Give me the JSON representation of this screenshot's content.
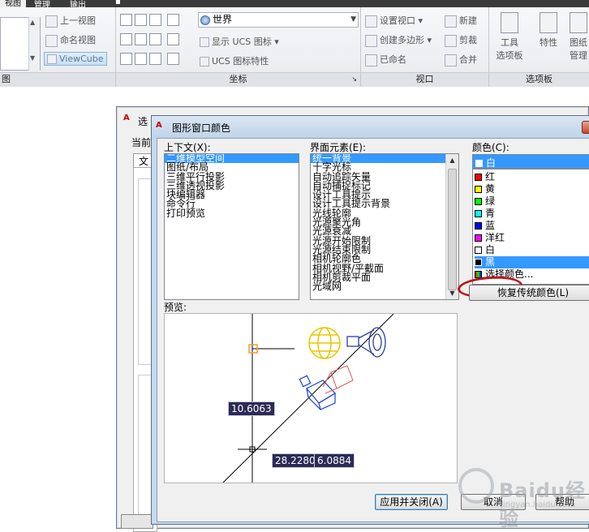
{
  "ribbon": {
    "tabs": [
      "视图",
      "管理",
      "输出"
    ],
    "view": {
      "upper_view": "上一视图",
      "named_view": "命名视图",
      "viewcube": "ViewCube"
    },
    "coords": {
      "world": "世界",
      "show_ucs_icon": "显示 UCS 图标",
      "ucs_icon_props": "UCS 图标特性",
      "panel_title": "坐标"
    },
    "viewport": {
      "set_viewport": "设置视口",
      "new": "新建",
      "create_polygon": "创建多边形",
      "clip": "剪裁",
      "named": "已命名",
      "merge": "合并",
      "panel_title": "视口"
    },
    "palettes": {
      "tool_palette_1": "工具",
      "tool_palette_2": "选项板",
      "properties": "特性",
      "sheet_set_1": "图纸",
      "sheet_set_2": "管理",
      "panel_title": "选项板"
    },
    "left_panel_title": "图"
  },
  "options_dialog": {
    "title_fragment": "选",
    "current_fragment": "当前",
    "tab_fragment": "文"
  },
  "color_dialog": {
    "title": "图形窗口颜色",
    "context_label": "上下文(X):",
    "contexts": [
      "二维模型空间",
      "图纸/布局",
      "三维平行投影",
      "三维透视投影",
      "块编辑器",
      "命令行",
      "打印预览"
    ],
    "element_label": "界面元素(E):",
    "elements": [
      "统一背景",
      "十字光标",
      "自动追踪矢量",
      "自动捕捉标记",
      "设计工具提示",
      "设计工具提示背景",
      "光线轮廓",
      "光源聚光角",
      "光源衰减",
      "光源开始限制",
      "光源结束限制",
      "相机轮廓色",
      "相机视野/平截面",
      "相机剪裁平面",
      "光域网"
    ],
    "color_label": "颜色(C):",
    "selected_color": "白",
    "colors": [
      {
        "name": "红",
        "hex": "#ff0000"
      },
      {
        "name": "黄",
        "hex": "#ffff00"
      },
      {
        "name": "绿",
        "hex": "#00ff00"
      },
      {
        "name": "青",
        "hex": "#00ffff"
      },
      {
        "name": "蓝",
        "hex": "#0000ff"
      },
      {
        "name": "洋红",
        "hex": "#ff00ff"
      },
      {
        "name": "白",
        "hex": "#ffffff"
      },
      {
        "name": "黑",
        "hex": "#000000"
      },
      {
        "name": "选择颜色...",
        "hex": ""
      }
    ],
    "restore_button": "恢复传统颜色(L)",
    "preview_label": "预览:",
    "dim_values": [
      "10.6063",
      "28.2280",
      "6.0884"
    ],
    "apply_button": "应用并关闭(A)",
    "cancel_button": "取消",
    "help_button": "帮助"
  },
  "watermark": {
    "text": "Baidu经验",
    "url": "jingyan.baidu.com"
  }
}
